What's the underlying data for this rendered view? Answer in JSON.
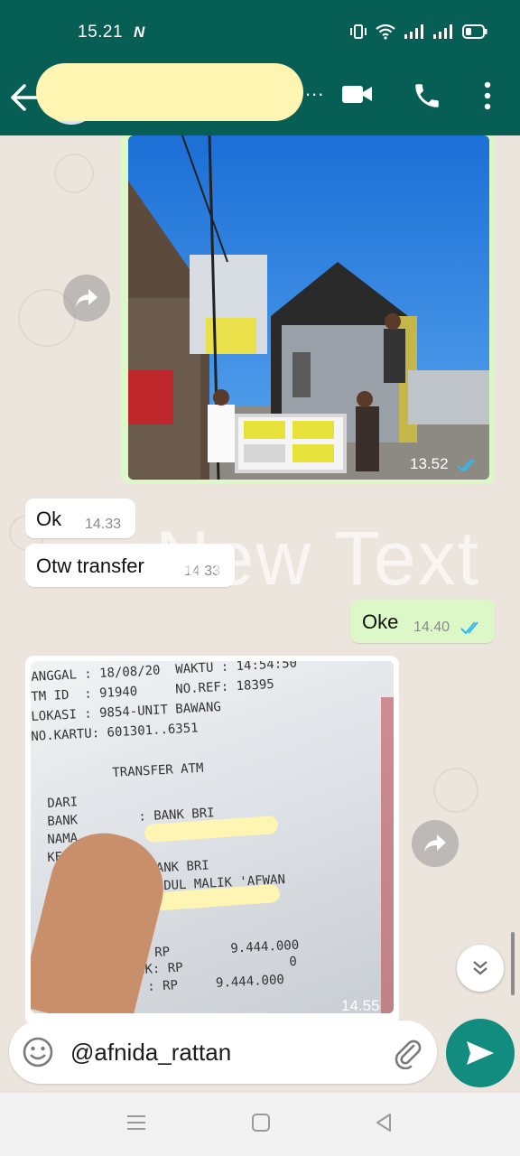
{
  "status_bar": {
    "time": "15.21",
    "nfc": "N"
  },
  "header": {
    "contact_name_redacted": "",
    "more_indicator": "..."
  },
  "messages": [
    {
      "type": "image",
      "direction": "outgoing",
      "time": "13.52",
      "status": "read"
    },
    {
      "type": "text",
      "direction": "incoming",
      "text": "Ok",
      "time": "14.33"
    },
    {
      "type": "text",
      "direction": "incoming",
      "text": "Otw transfer",
      "time": "14 33"
    },
    {
      "type": "text",
      "direction": "outgoing",
      "text": "Oke",
      "time": "14.40",
      "status": "read"
    },
    {
      "type": "image",
      "direction": "incoming",
      "time": "14.55"
    }
  ],
  "receipt": {
    "line1": "ANGGAL : 18/08/20  WAKTU : 14:54:50",
    "line2": "TM ID  : 91940     NO.REF: 18395",
    "line3": "LOKASI : 9854-UNIT BAWANG",
    "line4": "NO.KARTU: 601301..6351",
    "line5": "TRANSFER ATM",
    "line6": "DARI",
    "line7": "BANK        : BANK BRI",
    "line8": "NAMA",
    "line9": "KEP",
    "line10": "BANK BRI",
    "line11": "ABDUL MALIK 'AFWAN",
    "line12": ": RP        9.444.000",
    "line13": "N BANK: RP              0",
    "line14": "OTAL   : RP     9.444.000"
  },
  "watermark": "New Text",
  "composer": {
    "value": "@afnida_rattan"
  },
  "colors": {
    "header_bg": "#075e54",
    "outgoing_bubble": "#dcf8c6",
    "incoming_bubble": "#ffffff",
    "send_button": "#128c7e",
    "read_ticks": "#34b7f1"
  }
}
